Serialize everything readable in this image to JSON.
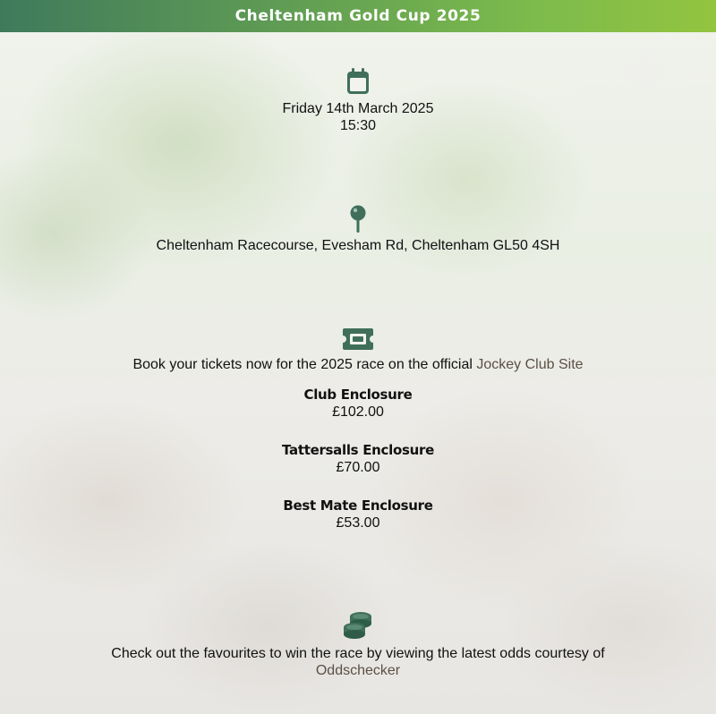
{
  "header": {
    "title": "Cheltenham Gold Cup 2025"
  },
  "date": {
    "day": "Friday 14th March 2025",
    "time": "15:30"
  },
  "location": {
    "address": "Cheltenham Racecourse, Evesham Rd, Cheltenham GL50 4SH"
  },
  "tickets": {
    "intro": "Book your tickets now for the 2025 race on the official",
    "link_text": "Jockey Club Site",
    "enclosures": [
      {
        "name": "Club Enclosure",
        "price": "£102.00"
      },
      {
        "name": "Tattersalls Enclosure",
        "price": "£70.00"
      },
      {
        "name": "Best Mate Enclosure",
        "price": "£53.00"
      }
    ]
  },
  "odds": {
    "intro": "Check out the favourites to win the race by viewing the latest odds courtesy of",
    "link_text": "Oddschecker"
  },
  "colors": {
    "icon": "#3f6f5a",
    "header_start": "#3f7a5c",
    "header_end": "#93c43f",
    "link": "#5c4f45"
  },
  "icons": [
    "calendar-icon",
    "map-pin-icon",
    "ticket-icon",
    "coins-icon"
  ]
}
